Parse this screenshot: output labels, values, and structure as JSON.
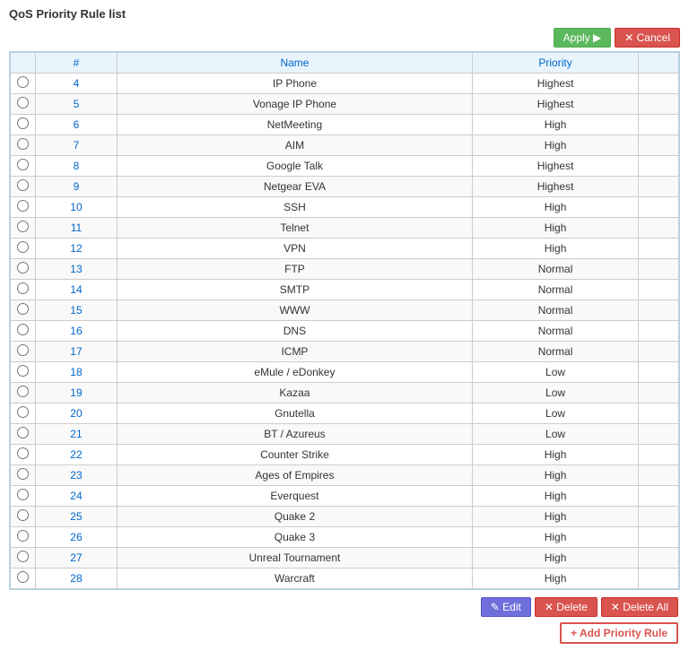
{
  "title": "QoS Priority Rule list",
  "buttons": {
    "apply": "Apply ▶",
    "cancel": "✕ Cancel",
    "edit": "✎ Edit",
    "delete": "✕ Delete",
    "delete_all": "✕ Delete All",
    "add": "+ Add Priority Rule"
  },
  "table": {
    "headers": [
      "",
      "#",
      "Name",
      "Priority",
      ""
    ],
    "rows": [
      {
        "id": "4",
        "name": "IP Phone",
        "priority": "Highest"
      },
      {
        "id": "5",
        "name": "Vonage IP Phone",
        "priority": "Highest"
      },
      {
        "id": "6",
        "name": "NetMeeting",
        "priority": "High"
      },
      {
        "id": "7",
        "name": "AIM",
        "priority": "High"
      },
      {
        "id": "8",
        "name": "Google Talk",
        "priority": "Highest"
      },
      {
        "id": "9",
        "name": "Netgear EVA",
        "priority": "Highest"
      },
      {
        "id": "10",
        "name": "SSH",
        "priority": "High"
      },
      {
        "id": "11",
        "name": "Telnet",
        "priority": "High"
      },
      {
        "id": "12",
        "name": "VPN",
        "priority": "High"
      },
      {
        "id": "13",
        "name": "FTP",
        "priority": "Normal"
      },
      {
        "id": "14",
        "name": "SMTP",
        "priority": "Normal"
      },
      {
        "id": "15",
        "name": "WWW",
        "priority": "Normal"
      },
      {
        "id": "16",
        "name": "DNS",
        "priority": "Normal"
      },
      {
        "id": "17",
        "name": "ICMP",
        "priority": "Normal"
      },
      {
        "id": "18",
        "name": "eMule / eDonkey",
        "priority": "Low"
      },
      {
        "id": "19",
        "name": "Kazaa",
        "priority": "Low"
      },
      {
        "id": "20",
        "name": "Gnutella",
        "priority": "Low"
      },
      {
        "id": "21",
        "name": "BT / Azureus",
        "priority": "Low"
      },
      {
        "id": "22",
        "name": "Counter Strike",
        "priority": "High"
      },
      {
        "id": "23",
        "name": "Ages of Empires",
        "priority": "High"
      },
      {
        "id": "24",
        "name": "Everquest",
        "priority": "High"
      },
      {
        "id": "25",
        "name": "Quake 2",
        "priority": "High"
      },
      {
        "id": "26",
        "name": "Quake 3",
        "priority": "High"
      },
      {
        "id": "27",
        "name": "Unreal Tournament",
        "priority": "High"
      },
      {
        "id": "28",
        "name": "Warcraft",
        "priority": "High"
      }
    ]
  }
}
